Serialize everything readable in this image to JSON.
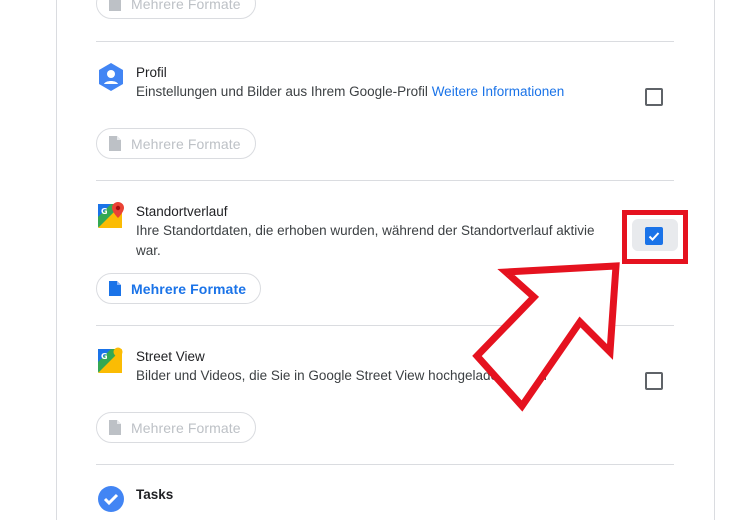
{
  "items": [
    {
      "id": "prev",
      "format_label": "Mehrere Formate",
      "format_active": false
    },
    {
      "id": "profil",
      "title": "Profil",
      "description": "Einstellungen und Bilder aus Ihrem Google-Profil",
      "link": "Weitere Informationen",
      "checked": false,
      "format_label": "Mehrere Formate",
      "format_active": false,
      "icon": "profile-hexagon-icon"
    },
    {
      "id": "standortverlauf",
      "title": "Standortverlauf",
      "description_line1": "Ihre Standortdaten, die erhoben wurden, während der Standortverlauf aktivie",
      "description_line2": "war.",
      "checked": true,
      "format_label": "Mehrere Formate",
      "format_active": true,
      "icon": "google-maps-icon"
    },
    {
      "id": "streetview",
      "title": "Street View",
      "description": "Bilder und Videos, die Sie in Google Street View hochgeladen haben",
      "checked": false,
      "format_label": "Mehrere Formate",
      "format_active": false,
      "icon": "street-view-icon"
    },
    {
      "id": "tasks",
      "title": "Tasks",
      "icon": "tasks-check-icon"
    }
  ],
  "colors": {
    "accent": "#1a73e8",
    "highlight": "#e5121f",
    "divider": "#dadce0",
    "disabled_text": "#bdc1c6"
  }
}
